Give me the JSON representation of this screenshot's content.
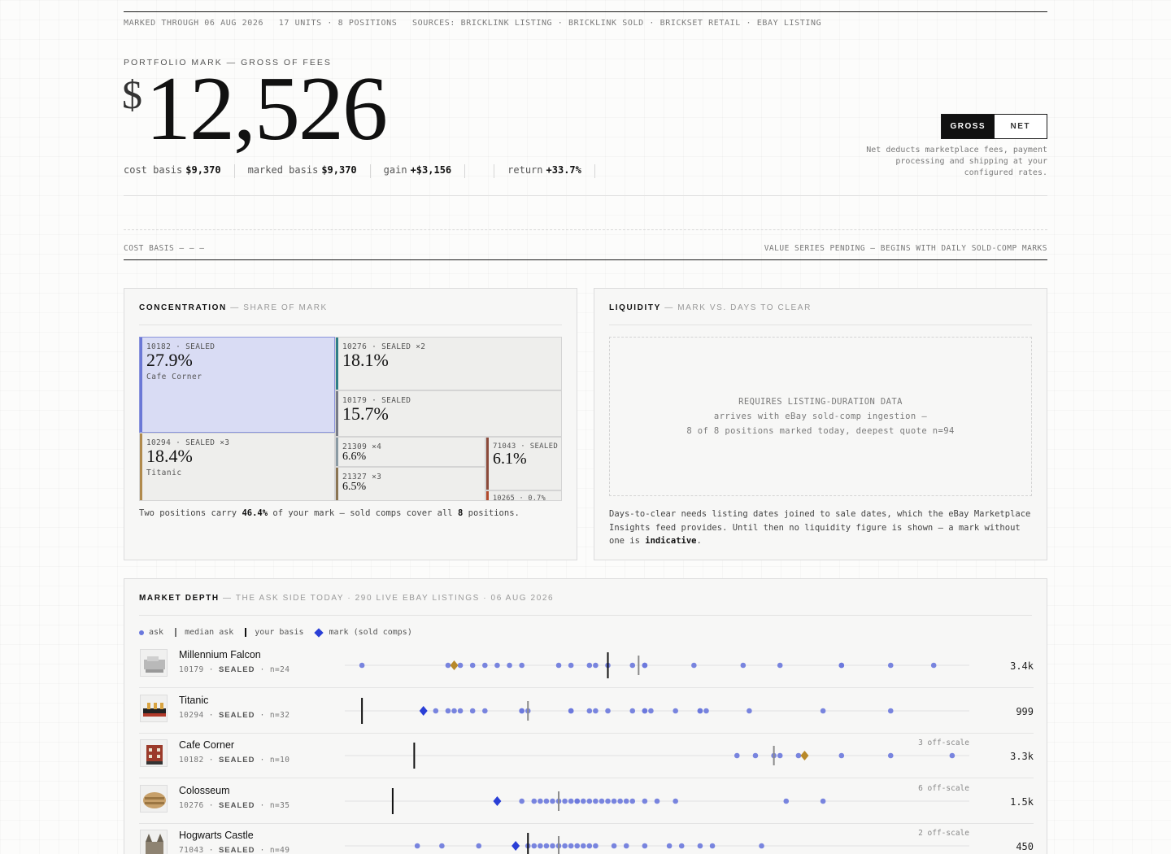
{
  "meta": {
    "marked": "MARKED THROUGH 06 AUG 2026",
    "units": "17 UNITS · 8 POSITIONS",
    "sources": "SOURCES: BRICKLINK LISTING · BRICKLINK SOLD · BRICKSET RETAIL · EBAY LISTING"
  },
  "hero": {
    "label": "PORTFOLIO MARK — GROSS OF FEES",
    "currency": "$",
    "value": "12,526"
  },
  "stats": {
    "cost_basis_label": "cost basis",
    "cost_basis": "$9,370",
    "marked_basis_label": "marked basis",
    "marked_basis": "$9,370",
    "gain_label": "gain",
    "gain": "+$3,156",
    "return_label": "return",
    "return": "+33.7%"
  },
  "toggle": {
    "gross": "GROSS",
    "net": "NET",
    "active": "GROSS",
    "note": "Net deducts marketplace fees, payment processing and shipping at your configured rates."
  },
  "chart_strip": {
    "left": "COST BASIS — — —",
    "right": "VALUE SERIES PENDING — BEGINS WITH DAILY SOLD-COMP MARKS"
  },
  "concentration": {
    "title": "CONCENTRATION",
    "subtitle": "— SHARE OF MARK",
    "tiles": [
      {
        "id": "10182 · SEALED",
        "pct": "27.9%",
        "name": "Cafe Corner",
        "color": "#6b78d6"
      },
      {
        "id": "10276 · SEALED ×2",
        "pct": "18.1%",
        "name": "",
        "color": "#2e7e86"
      },
      {
        "id": "10294 · SEALED ×3",
        "pct": "18.4%",
        "name": "Titanic",
        "color": "#b08a4c"
      },
      {
        "id": "10179 · SEALED",
        "pct": "15.7%",
        "name": "",
        "color": "#777b86"
      },
      {
        "id": "21309 ×4",
        "pct": "6.6%",
        "name": "",
        "color": "#8a9aa3"
      },
      {
        "id": "21327 ×3",
        "pct": "6.5%",
        "name": "",
        "color": "#8a7452"
      },
      {
        "id": "71043 · SEALED",
        "pct": "6.1%",
        "name": "",
        "color": "#8b4a3a"
      },
      {
        "id": "10265 · 0.7%",
        "pct": "",
        "name": "",
        "color": "#b24a2c"
      }
    ],
    "note_a": "Two positions carry",
    "note_b": "46.4%",
    "note_c": "of your mark — sold comps cover all",
    "note_d": "8",
    "note_e": "positions."
  },
  "liquidity": {
    "title": "LIQUIDITY",
    "subtitle": "— MARK VS. DAYS TO CLEAR",
    "box_line1": "REQUIRES LISTING-DURATION DATA",
    "box_line2": "arrives with eBay sold-comp ingestion —",
    "box_line3": "8 of 8 positions marked today, deepest quote n=94",
    "note_a": "Days-to-clear needs listing dates joined to sale dates, which the eBay Marketplace Insights feed provides. Until then no liquidity figure is shown — a mark without one is",
    "note_b": "indicative",
    "note_c": "."
  },
  "depth": {
    "title": "MARKET DEPTH",
    "subtitle": "— THE ASK SIDE TODAY · 290 LIVE EBAY LISTINGS · 06 AUG 2026",
    "legend": {
      "ask": "ask",
      "median": "median ask",
      "basis": "your basis",
      "mark": "mark (sold comps)"
    },
    "colors": {
      "ask": "#6a78dd",
      "mark": "#2a3fd6",
      "mark_alt": "#b8892a",
      "median": "#8a8a8a",
      "basis": "#111111"
    },
    "rows": [
      {
        "name": "Millennium Falcon",
        "set": "10179",
        "cond": "SEALED",
        "n": "n=24",
        "value": "3.4k",
        "offscale": "",
        "mark_alt": true,
        "asks": [
          0.02,
          0.16,
          0.18,
          0.2,
          0.22,
          0.24,
          0.26,
          0.28,
          0.34,
          0.36,
          0.39,
          0.4,
          0.42,
          0.46,
          0.48,
          0.48,
          0.56,
          0.64,
          0.7,
          0.8,
          0.8,
          0.88,
          0.95
        ],
        "median": 0.47,
        "basis": 0.42,
        "mark": 0.17
      },
      {
        "name": "Titanic",
        "set": "10294",
        "cond": "SEALED",
        "n": "n=32",
        "value": "999",
        "offscale": "",
        "mark_alt": false,
        "asks": [
          0.14,
          0.16,
          0.17,
          0.18,
          0.2,
          0.22,
          0.28,
          0.28,
          0.29,
          0.36,
          0.36,
          0.39,
          0.4,
          0.42,
          0.46,
          0.48,
          0.48,
          0.49,
          0.53,
          0.57,
          0.57,
          0.58,
          0.65,
          0.77,
          0.88
        ],
        "median": 0.29,
        "basis": 0.02,
        "mark": 0.12
      },
      {
        "name": "Cafe Corner",
        "set": "10182",
        "cond": "SEALED",
        "n": "n=10",
        "value": "3.3k",
        "offscale": "3 off-scale",
        "mark_alt": true,
        "asks": [
          0.63,
          0.66,
          0.69,
          0.7,
          0.73,
          0.8,
          0.88,
          0.98
        ],
        "median": 0.69,
        "basis": 0.105,
        "mark": 0.74
      },
      {
        "name": "Colosseum",
        "set": "10276",
        "cond": "SEALED",
        "n": "n=35",
        "value": "1.5k",
        "offscale": "6 off-scale",
        "mark_alt": false,
        "asks": [
          0.28,
          0.3,
          0.31,
          0.32,
          0.33,
          0.34,
          0.35,
          0.36,
          0.37,
          0.37,
          0.38,
          0.39,
          0.4,
          0.41,
          0.42,
          0.43,
          0.44,
          0.45,
          0.46,
          0.48,
          0.5,
          0.53,
          0.71,
          0.77
        ],
        "median": 0.34,
        "basis": 0.07,
        "mark": 0.24
      },
      {
        "name": "Hogwarts Castle",
        "set": "71043",
        "cond": "SEALED",
        "n": "n=49",
        "value": "450",
        "offscale": "2 off-scale",
        "mark_alt": false,
        "asks": [
          0.11,
          0.15,
          0.21,
          0.29,
          0.3,
          0.31,
          0.32,
          0.33,
          0.34,
          0.35,
          0.36,
          0.37,
          0.38,
          0.39,
          0.4,
          0.43,
          0.45,
          0.48,
          0.52,
          0.54,
          0.57,
          0.59,
          0.67
        ],
        "median": 0.34,
        "basis": 0.29,
        "mark": 0.27
      }
    ]
  }
}
